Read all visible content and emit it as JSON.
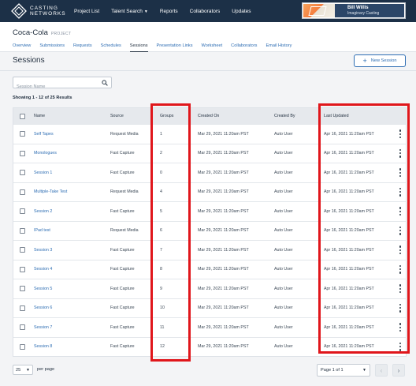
{
  "brand": {
    "line1": "CASTING",
    "line2": "NETWORKS"
  },
  "nav": {
    "project_list": "Project List",
    "talent_search": "Talent Search",
    "reports": "Reports",
    "collaborators": "Collaborators",
    "updates": "Updates"
  },
  "user": {
    "name": "Bill Willis",
    "org": "Imaginary Casting"
  },
  "project": {
    "title": "Coca-Cola",
    "tag": "PROJECT"
  },
  "tabs": [
    {
      "label": "Overview"
    },
    {
      "label": "Submissions"
    },
    {
      "label": "Requests"
    },
    {
      "label": "Schedules"
    },
    {
      "label": "Sessions"
    },
    {
      "label": "Presentation Links"
    },
    {
      "label": "Worksheet"
    },
    {
      "label": "Collaborators"
    },
    {
      "label": "Email History"
    }
  ],
  "active_tab": "Sessions",
  "page": {
    "title": "Sessions",
    "new_button": "New Session"
  },
  "search": {
    "placeholder": "Session Name",
    "value": ""
  },
  "showing": "Showing 1 - 12 of 25 Results",
  "table": {
    "columns": {
      "name": "Name",
      "source": "Source",
      "groups": "Groups",
      "created_on": "Created On",
      "created_by": "Created By",
      "last_updated": "Last Updated"
    },
    "rows": [
      {
        "name": "Self Tapes",
        "source": "Request Media",
        "groups": "1",
        "created_on": "Mar 29, 2021 11:20am PST",
        "created_by": "Auto User",
        "last_updated": "Apr 16, 2021 11:20am PST"
      },
      {
        "name": "Monologues",
        "source": "Fast Capture",
        "groups": "2",
        "created_on": "Mar 29, 2021 11:20am PST",
        "created_by": "Auto User",
        "last_updated": "Apr 16, 2021 11:20am PST"
      },
      {
        "name": "Session 1",
        "source": "Fast Capture",
        "groups": "0",
        "created_on": "Mar 29, 2021 11:20am PST",
        "created_by": "Auto User",
        "last_updated": "Apr 16, 2021 11:20am PST"
      },
      {
        "name": "Multiple-Take Test",
        "source": "Request Media",
        "groups": "4",
        "created_on": "Mar 29, 2021 11:20am PST",
        "created_by": "Auto User",
        "last_updated": "Apr 16, 2021 11:20am PST"
      },
      {
        "name": "Session 2",
        "source": "Fast Capture",
        "groups": "5",
        "created_on": "Mar 29, 2021 11:20am PST",
        "created_by": "Auto User",
        "last_updated": "Apr 16, 2021 11:20am PST"
      },
      {
        "name": "IPad test",
        "source": "Request Media",
        "groups": "6",
        "created_on": "Mar 29, 2021 11:20am PST",
        "created_by": "Auto User",
        "last_updated": "Apr 16, 2021 11:20am PST"
      },
      {
        "name": "Session 3",
        "source": "Fast Capture",
        "groups": "7",
        "created_on": "Mar 29, 2021 11:20am PST",
        "created_by": "Auto User",
        "last_updated": "Apr 16, 2021 11:20am PST"
      },
      {
        "name": "Session 4",
        "source": "Fast Capture",
        "groups": "8",
        "created_on": "Mar 29, 2021 11:20am PST",
        "created_by": "Auto User",
        "last_updated": "Apr 16, 2021 11:20am PST"
      },
      {
        "name": "Session 5",
        "source": "Fast Capture",
        "groups": "9",
        "created_on": "Mar 29, 2021 11:20am PST",
        "created_by": "Auto User",
        "last_updated": "Apr 16, 2021 11:20am PST"
      },
      {
        "name": "Session 6",
        "source": "Fast Capture",
        "groups": "10",
        "created_on": "Mar 29, 2021 11:20am PST",
        "created_by": "Auto User",
        "last_updated": "Apr 16, 2021 11:20am PST"
      },
      {
        "name": "Session 7",
        "source": "Fast Capture",
        "groups": "11",
        "created_on": "Mar 29, 2021 11:20am PST",
        "created_by": "Auto User",
        "last_updated": "Apr 16, 2021 11:20am PST"
      },
      {
        "name": "Session 8",
        "source": "Fast Capture",
        "groups": "12",
        "created_on": "Mar 29, 2021 11:20am PST",
        "created_by": "Auto User",
        "last_updated": "Apr 16, 2021 11:20am PST"
      }
    ]
  },
  "pagination": {
    "per_page_value": "25",
    "per_page_label": "per page",
    "page_label": "Page 1 of 1",
    "prev_glyph": "‹",
    "next_glyph": "›"
  },
  "colors": {
    "topbar": "#1c3047",
    "link": "#2d6db3",
    "highlight": "#e0161b",
    "table_header": "#e6e9ed"
  },
  "icons": {
    "logo": "diamond-logo-icon",
    "search": "search-icon",
    "add": "plus-icon",
    "row_menu": "kebab-menu-icon",
    "select": "chevron-down-icon"
  }
}
